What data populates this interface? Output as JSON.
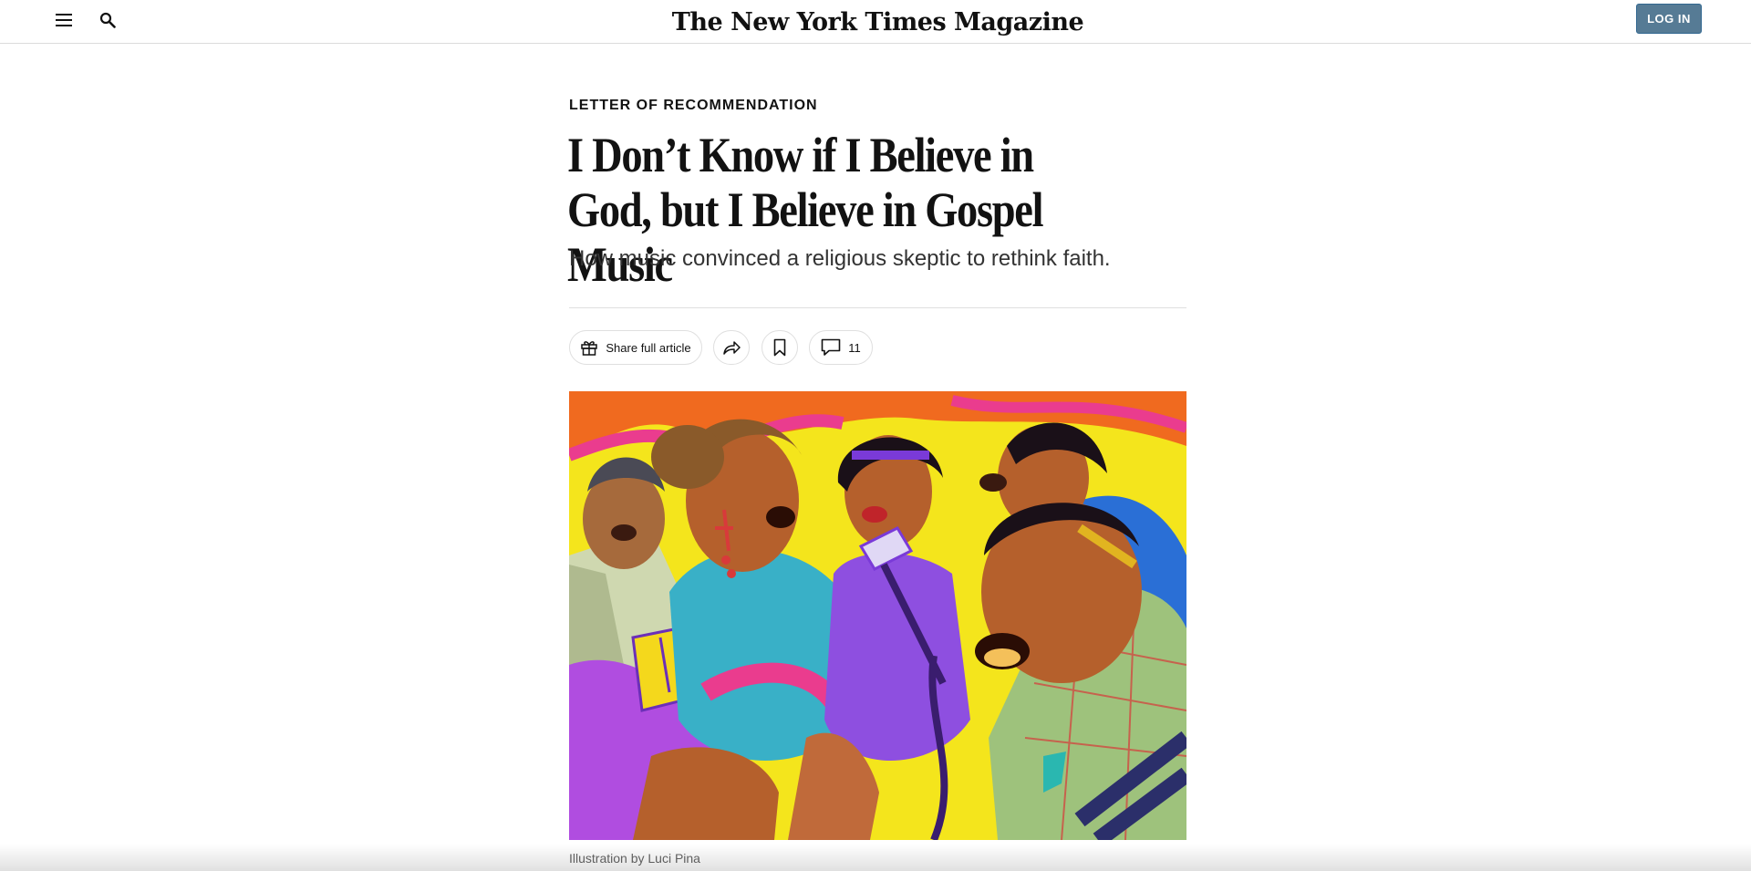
{
  "header": {
    "masthead": "The New York Times Magazine",
    "login_label": "LOG IN",
    "menu_icon": "menu-icon",
    "search_icon": "search-icon"
  },
  "article": {
    "kicker": "LETTER OF RECOMMENDATION",
    "headline": "I Don’t Know if I Believe in God, but I Believe in Gospel Music",
    "dek": "How music convinced a religious skeptic to rethink faith.",
    "caption": "Illustration by Luci Pina"
  },
  "actions": {
    "share_full_label": "Share full article",
    "comment_count": "11",
    "icons": [
      "gift-icon",
      "share-arrow-icon",
      "bookmark-icon",
      "comment-bubble-icon"
    ]
  },
  "colors": {
    "login_bg": "#567b95",
    "text": "#121212",
    "rule": "#dfdfdf"
  }
}
